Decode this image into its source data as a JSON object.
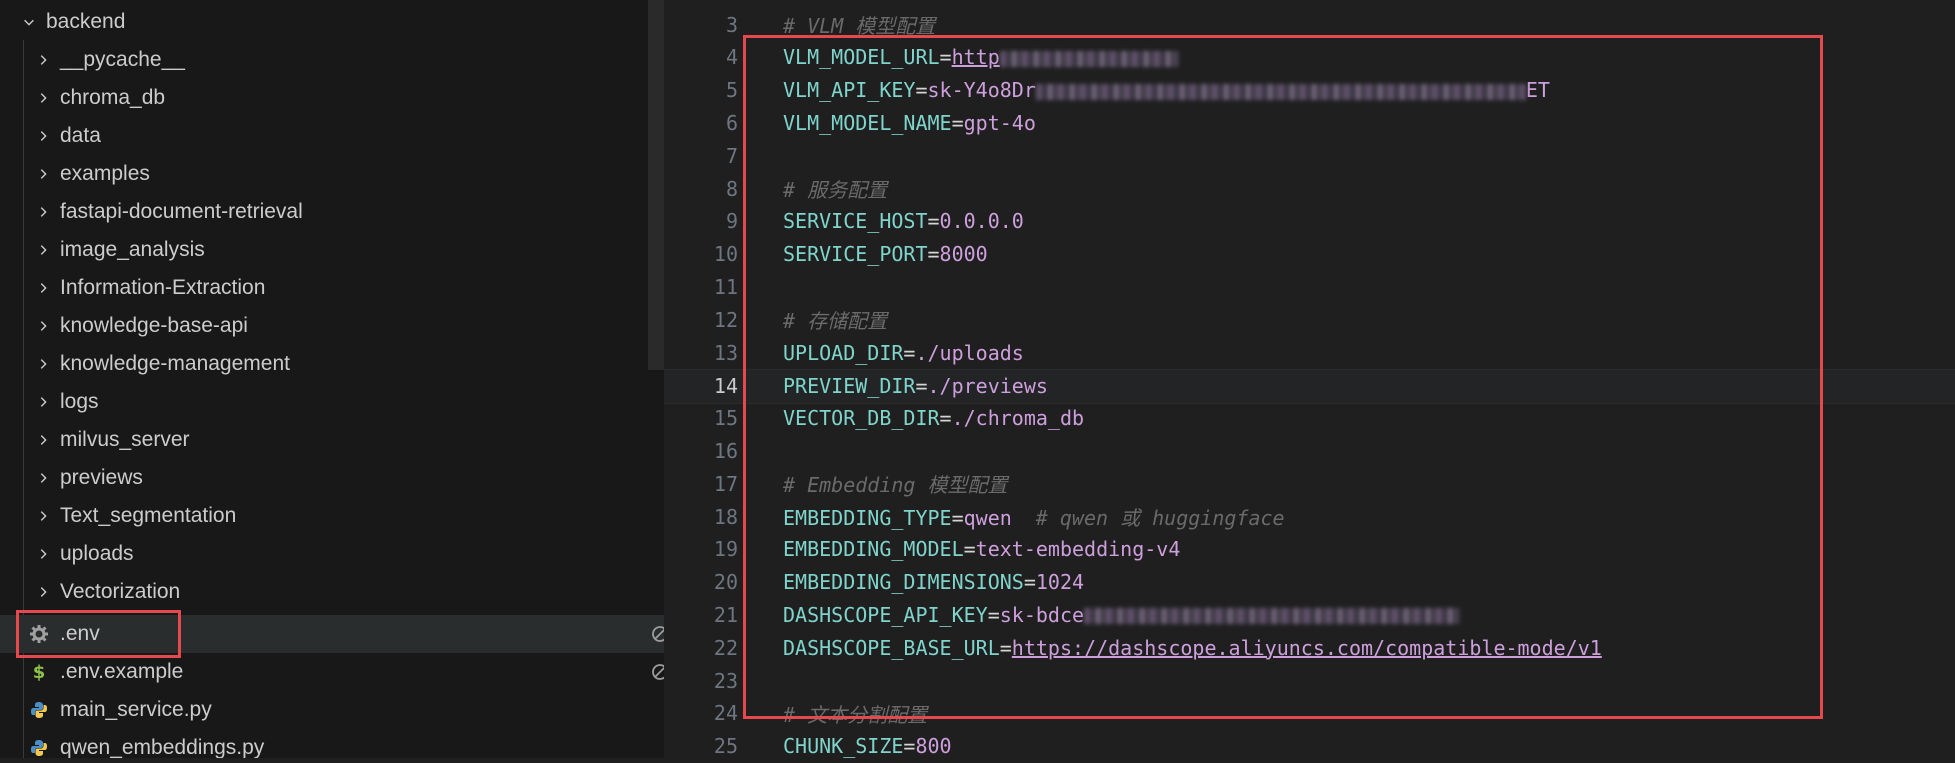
{
  "sidebar": {
    "root": {
      "label": "backend"
    },
    "folders": [
      {
        "label": "__pycache__"
      },
      {
        "label": "chroma_db"
      },
      {
        "label": "data"
      },
      {
        "label": "examples"
      },
      {
        "label": "fastapi-document-retrieval"
      },
      {
        "label": "image_analysis"
      },
      {
        "label": "Information-Extraction"
      },
      {
        "label": "knowledge-base-api"
      },
      {
        "label": "knowledge-management"
      },
      {
        "label": "logs"
      },
      {
        "label": "milvus_server"
      },
      {
        "label": "previews"
      },
      {
        "label": "Text_segmentation"
      },
      {
        "label": "uploads"
      },
      {
        "label": "Vectorization"
      }
    ],
    "files": [
      {
        "label": ".env",
        "icon": "gear-icon"
      },
      {
        "label": ".env.example",
        "icon": "dollar-icon"
      },
      {
        "label": "main_service.py",
        "icon": "python-icon"
      },
      {
        "label": "qwen_embeddings.py",
        "icon": "python-icon"
      }
    ]
  },
  "editor": {
    "lines": [
      {
        "num": "3",
        "comment": "# VLM 模型配置"
      },
      {
        "num": "4",
        "key": "VLM_MODEL_URL",
        "val": "http"
      },
      {
        "num": "5",
        "key": "VLM_API_KEY",
        "val": "sk-Y4o8Dr",
        "val_tail": "ET"
      },
      {
        "num": "6",
        "key": "VLM_MODEL_NAME",
        "val": "gpt-4o"
      },
      {
        "num": "7"
      },
      {
        "num": "8",
        "comment": "# 服务配置"
      },
      {
        "num": "9",
        "key": "SERVICE_HOST",
        "val": "0.0.0.0"
      },
      {
        "num": "10",
        "key": "SERVICE_PORT",
        "val": "8000"
      },
      {
        "num": "11"
      },
      {
        "num": "12",
        "comment": "# 存储配置"
      },
      {
        "num": "13",
        "key": "UPLOAD_DIR",
        "val": "./uploads"
      },
      {
        "num": "14",
        "key": "PREVIEW_DIR",
        "val": "./previews"
      },
      {
        "num": "15",
        "key": "VECTOR_DB_DIR",
        "val": "./chroma_db"
      },
      {
        "num": "16"
      },
      {
        "num": "17",
        "comment": "# Embedding 模型配置"
      },
      {
        "num": "18",
        "key": "EMBEDDING_TYPE",
        "val": "qwen",
        "trail": "# qwen 或 huggingface"
      },
      {
        "num": "19",
        "key": "EMBEDDING_MODEL",
        "val": "text-embedding-v4"
      },
      {
        "num": "20",
        "key": "EMBEDDING_DIMENSIONS",
        "val": "1024"
      },
      {
        "num": "21",
        "key": "DASHSCOPE_API_KEY",
        "val": "sk-bdce"
      },
      {
        "num": "22",
        "key": "DASHSCOPE_BASE_URL",
        "val": "https://dashscope.aliyuncs.com/compatible-mode/v1"
      },
      {
        "num": "23"
      },
      {
        "num": "24",
        "comment": "# 文本分割配置"
      },
      {
        "num": "25",
        "key": "CHUNK_SIZE",
        "val": "800"
      }
    ],
    "eq": "="
  },
  "colors": {
    "highlight": "#e5484d",
    "key": "#7fd4cc",
    "value": "#ce9fdd",
    "comment": "#6a6a6a"
  }
}
